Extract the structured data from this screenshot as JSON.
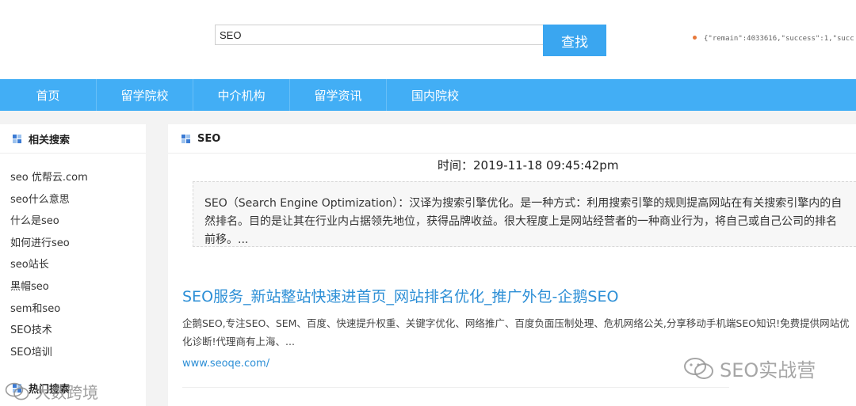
{
  "header": {
    "search_value": "SEO",
    "search_button": "查找",
    "api_response": "{\"remain\":4033616,\"success\":1,\"succ"
  },
  "nav": {
    "items": [
      "首页",
      "留学院校",
      "中介机构",
      "留学资讯",
      "国内院校"
    ]
  },
  "sidebar": {
    "title": "相关搜索",
    "items": [
      "seo 优帮云.com",
      "seo什么意思",
      "什么是seo",
      "如何进行seo",
      "seo站长",
      "黑帽seo",
      "sem和seo",
      "SEO技术",
      "SEO培训"
    ],
    "title2": "热门搜索"
  },
  "main": {
    "title": "SEO",
    "time": "时间：2019-11-18 09:45:42pm",
    "summary": "SEO（Search Engine Optimization）：汉译为搜索引擎优化。是一种方式：利用搜索引擎的规则提高网站在有关搜索引擎内的自然排名。目的是让其在行业内占据领先地位，获得品牌收益。很大程度上是网站经营者的一种商业行为，将自己或自己公司的排名前移。...",
    "result": {
      "title": "SEO服务_新站整站快速进首页_网站排名优化_推广外包-企鹅SEO",
      "desc": "企鹅SEO,专注SEO、SEM、百度、快速提升权重、关键字优化、网络推广、百度负面压制处理、危机网络公关,分享移动手机端SEO知识!免费提供网站优化诊断!代理商有上海、...",
      "url": "www.seoqe.com/"
    }
  },
  "watermarks": {
    "right": "SEO实战营",
    "left": "大数跨境"
  },
  "colors": {
    "nav_bg": "#42aef5",
    "button_bg": "#3aa6f0",
    "link": "#2d8fd6"
  }
}
